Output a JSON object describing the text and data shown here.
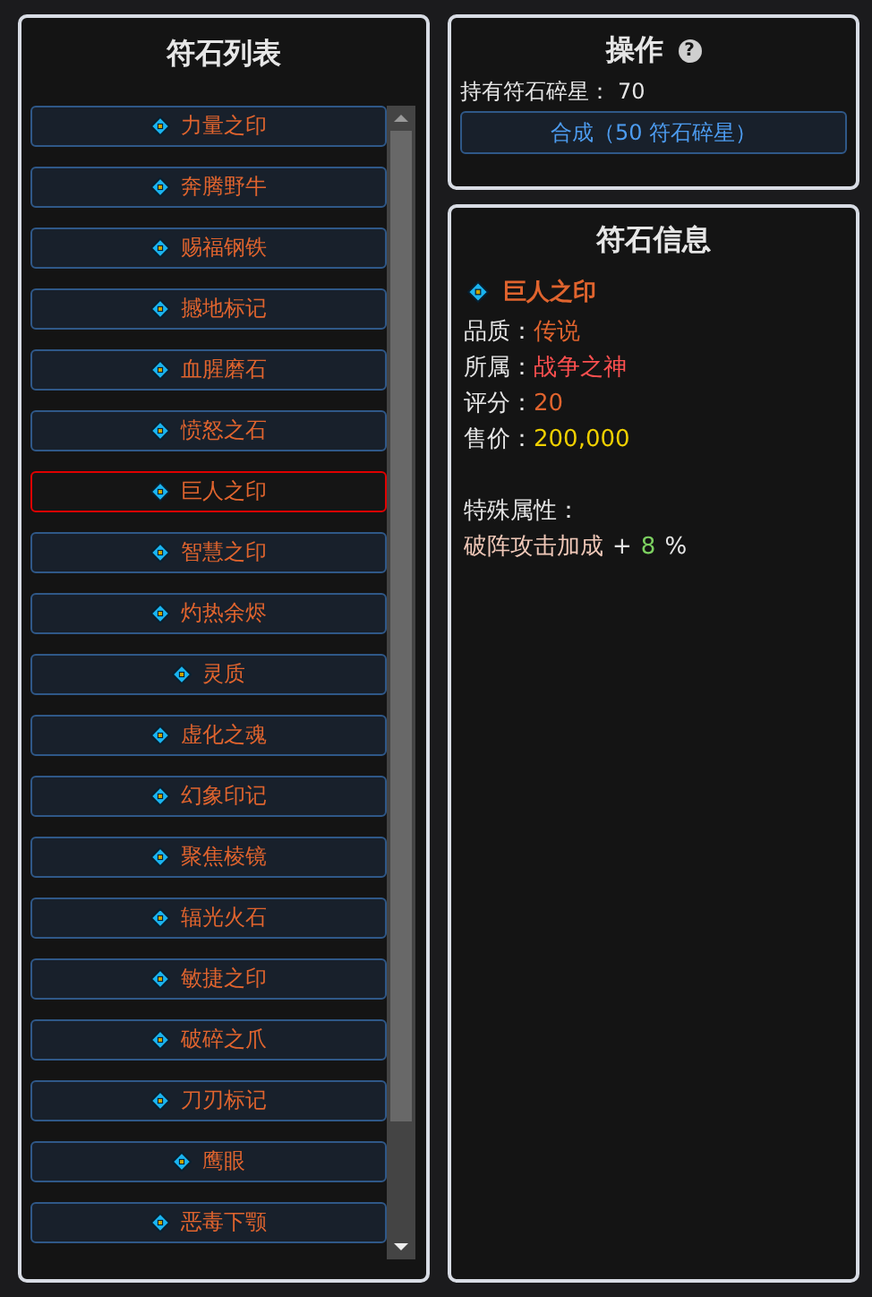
{
  "rune_list": {
    "title": "符石列表",
    "items": [
      {
        "name": "力量之印",
        "selected": false
      },
      {
        "name": "奔腾野牛",
        "selected": false
      },
      {
        "name": "赐福钢铁",
        "selected": false
      },
      {
        "name": "撼地标记",
        "selected": false
      },
      {
        "name": "血腥磨石",
        "selected": false
      },
      {
        "name": "愤怒之石",
        "selected": false
      },
      {
        "name": "巨人之印",
        "selected": true
      },
      {
        "name": "智慧之印",
        "selected": false
      },
      {
        "name": "灼热余烬",
        "selected": false
      },
      {
        "name": "灵质",
        "selected": false
      },
      {
        "name": "虚化之魂",
        "selected": false
      },
      {
        "name": "幻象印记",
        "selected": false
      },
      {
        "name": "聚焦棱镜",
        "selected": false
      },
      {
        "name": "辐光火石",
        "selected": false
      },
      {
        "name": "敏捷之印",
        "selected": false
      },
      {
        "name": "破碎之爪",
        "selected": false
      },
      {
        "name": "刀刃标记",
        "selected": false
      },
      {
        "name": "鹰眼",
        "selected": false
      },
      {
        "name": "恶毒下颚",
        "selected": false
      }
    ]
  },
  "operations": {
    "title": "操作",
    "help": "?",
    "shards_label": "持有符石碎星：",
    "shards_value": "70",
    "craft_button": "合成（50 符石碎星）"
  },
  "rune_info": {
    "title": "符石信息",
    "name": "巨人之印",
    "fields": [
      {
        "label": "品质：",
        "value": "传说",
        "color": "#e0642e"
      },
      {
        "label": "所属：",
        "value": "战争之神",
        "color": "#ff5050"
      },
      {
        "label": "评分：",
        "value": "20",
        "color": "#e0642e"
      },
      {
        "label": "售价：",
        "value": "200,000",
        "color": "#f0d000"
      }
    ],
    "special_title": "特殊属性：",
    "special": {
      "name": "破阵攻击加成",
      "sign": "+",
      "value": "8",
      "unit": "%"
    }
  }
}
